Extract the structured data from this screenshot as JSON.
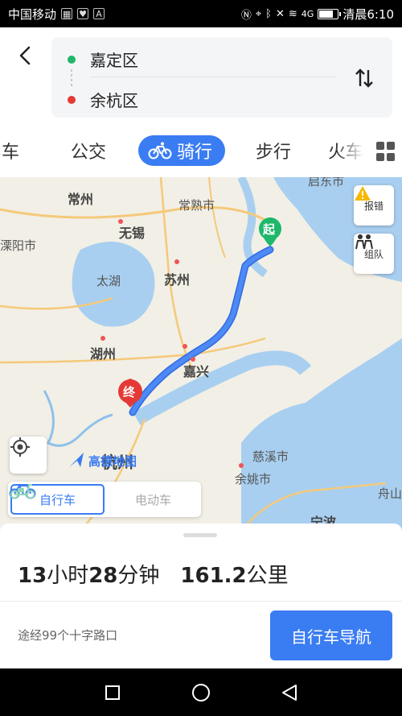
{
  "status_bar": {
    "carrier": "中国移动",
    "time": "清晨6:10",
    "signal_label": "4G"
  },
  "route": {
    "start": "嘉定区",
    "end": "余杭区"
  },
  "tabs": [
    {
      "label": "驾车"
    },
    {
      "label": "公交"
    },
    {
      "label": "骑行"
    },
    {
      "label": "步行"
    },
    {
      "label": "火车"
    }
  ],
  "map": {
    "labels": {
      "qidong": "启东市",
      "changzhou": "常州",
      "changshu": "常熟市",
      "wuxi": "无锡",
      "liyang": "溧阳市",
      "taihu": "太湖",
      "suzhou": "苏州",
      "huzhou": "湖州",
      "jiaxing": "嘉兴",
      "hangzhou": "杭州",
      "cixi": "慈溪市",
      "yuyao": "余姚市",
      "zhoushan": "舟山",
      "ningbo": "宁波",
      "gaode": "高德地图"
    },
    "marker_start": "起",
    "marker_end": "终",
    "report_label": "报错",
    "team_label": "组队",
    "colors": {
      "route": "#3a7cf2",
      "water": "#a8cff0",
      "land": "#f2efe6"
    }
  },
  "vehicle": {
    "bike": "自行车",
    "ebike": "电动车"
  },
  "summary": {
    "hours": "13",
    "hours_unit": "小时",
    "minutes": "28",
    "minutes_unit": "分钟",
    "distance": "161.2",
    "distance_unit": "公里",
    "crossings": "途经99个十字路口",
    "nav_button": "自行车导航"
  }
}
